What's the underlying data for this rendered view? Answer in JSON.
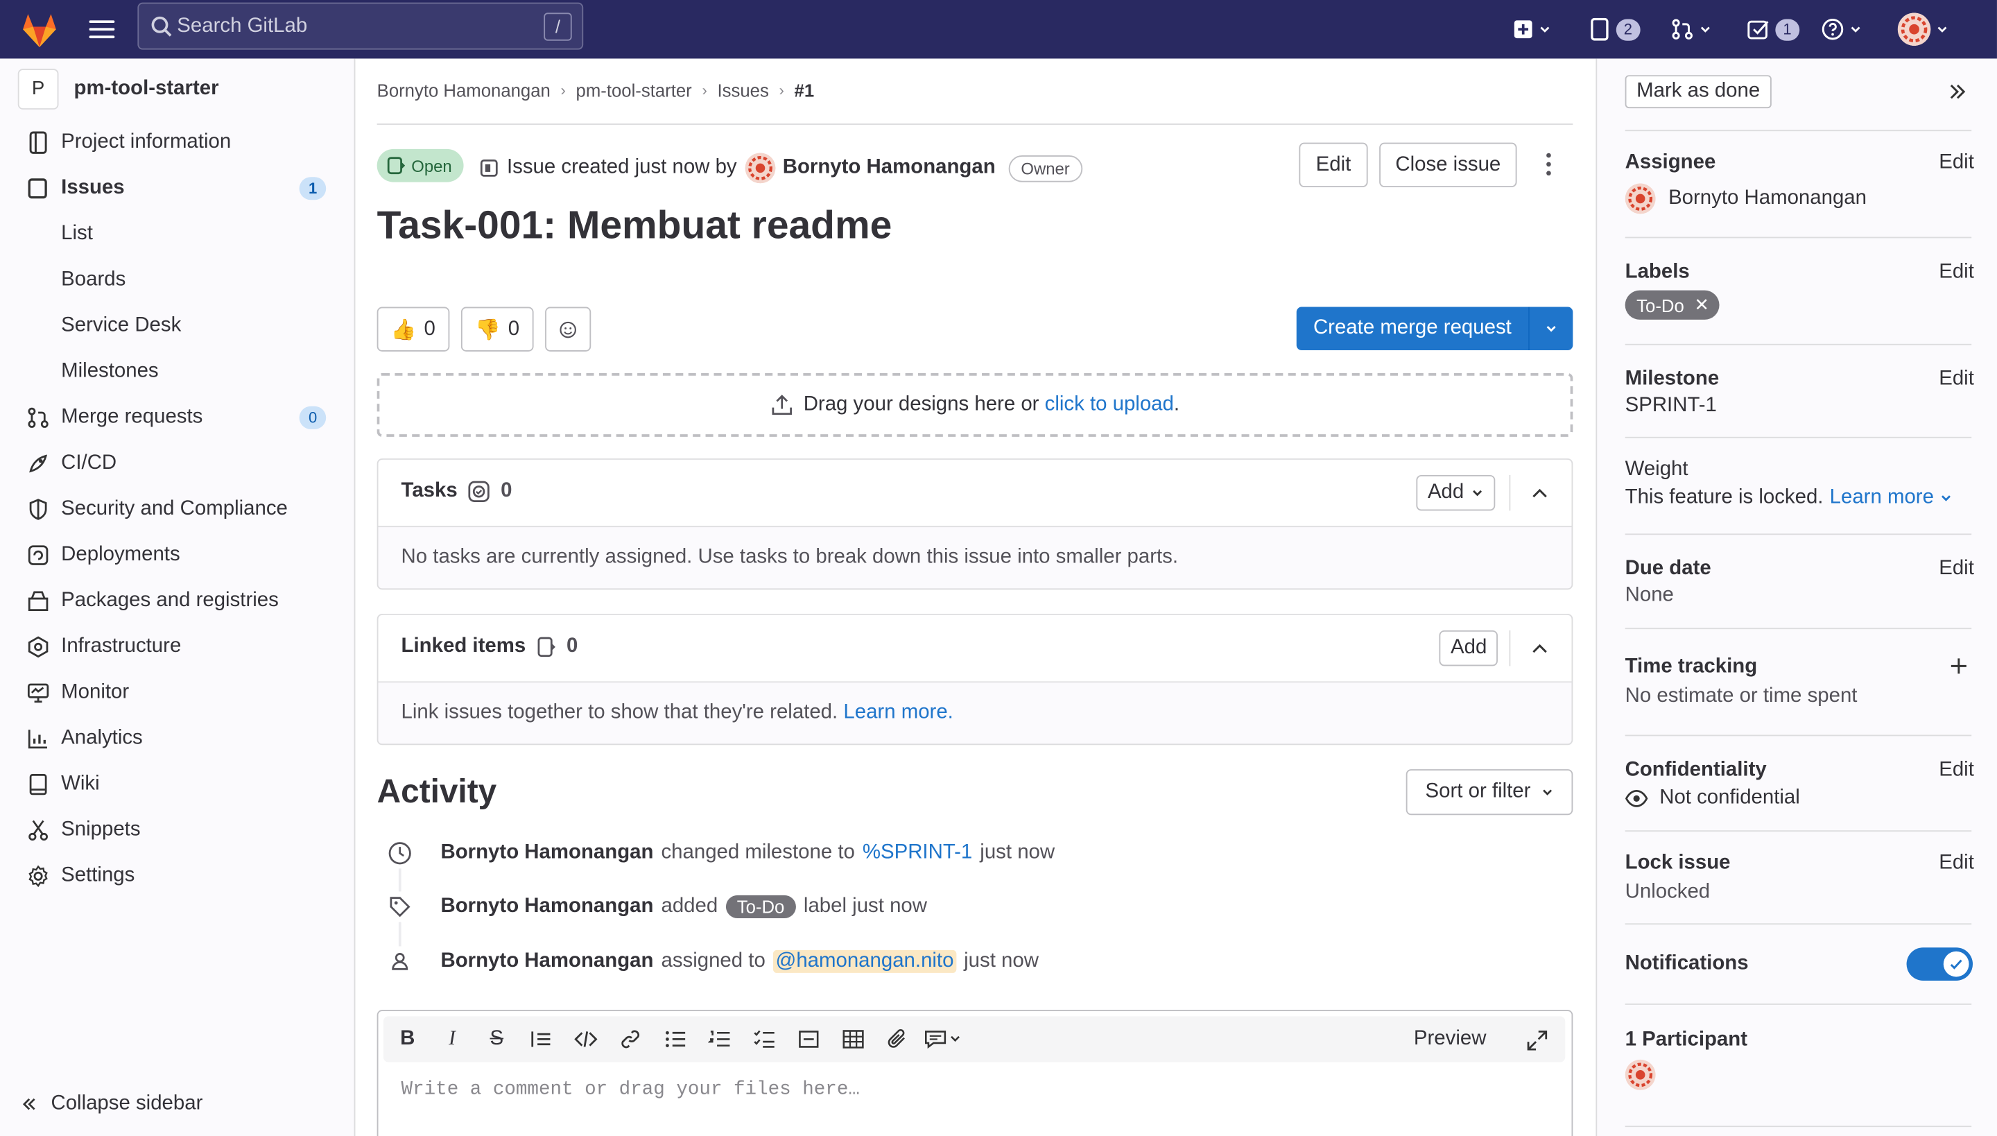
{
  "topbar": {
    "search_placeholder": "Search GitLab",
    "search_shortcut": "/",
    "issues_count": "2",
    "todos_count": "1"
  },
  "sidebar": {
    "project_initial": "P",
    "project_name": "pm-tool-starter",
    "items": [
      {
        "label": "Project information",
        "icon": "info-icon"
      },
      {
        "label": "Issues",
        "icon": "issues-icon",
        "count": "1"
      },
      {
        "label": "List"
      },
      {
        "label": "Boards"
      },
      {
        "label": "Service Desk"
      },
      {
        "label": "Milestones"
      },
      {
        "label": "Merge requests",
        "icon": "merge-request-icon",
        "count": "0"
      },
      {
        "label": "CI/CD",
        "icon": "rocket-icon"
      },
      {
        "label": "Security and Compliance",
        "icon": "shield-icon"
      },
      {
        "label": "Deployments",
        "icon": "deployments-icon"
      },
      {
        "label": "Packages and registries",
        "icon": "package-icon"
      },
      {
        "label": "Infrastructure",
        "icon": "cloud-icon"
      },
      {
        "label": "Monitor",
        "icon": "monitor-icon"
      },
      {
        "label": "Analytics",
        "icon": "chart-icon"
      },
      {
        "label": "Wiki",
        "icon": "book-icon"
      },
      {
        "label": "Snippets",
        "icon": "scissors-icon"
      },
      {
        "label": "Settings",
        "icon": "gear-icon"
      }
    ],
    "collapse_label": "Collapse sidebar"
  },
  "breadcrumb": [
    "Bornyto Hamonangan",
    "pm-tool-starter",
    "Issues",
    "#1"
  ],
  "issue": {
    "status": "Open",
    "created_text": "Issue created just now by",
    "author": "Bornyto Hamonangan",
    "role": "Owner",
    "edit_label": "Edit",
    "close_label": "Close issue",
    "title": "Task-001: Membuat readme",
    "thumbs_up": "0",
    "thumbs_down": "0",
    "create_mr_label": "Create merge request",
    "dropzone_text": "Drag your designs here or",
    "dropzone_link": "click to upload",
    "dropzone_end": "."
  },
  "tasks": {
    "title": "Tasks",
    "count": "0",
    "add_label": "Add",
    "empty_text": "No tasks are currently assigned. Use tasks to break down this issue into smaller parts."
  },
  "linked": {
    "title": "Linked items",
    "count": "0",
    "add_label": "Add",
    "text": "Link issues together to show that they're related.",
    "link": "Learn more."
  },
  "activity": {
    "title": "Activity",
    "sort_label": "Sort or filter",
    "events": [
      {
        "user": "Bornyto Hamonangan",
        "pre": "changed milestone to",
        "ref": "%SPRINT-1",
        "post": "just now"
      },
      {
        "user": "Bornyto Hamonangan",
        "pre": "added",
        "tag": "To-Do",
        "post": "label just now"
      },
      {
        "user": "Bornyto Hamonangan",
        "pre": "assigned to",
        "mention": "@hamonangan.nito",
        "post": "just now"
      }
    ],
    "preview_label": "Preview",
    "comment_placeholder": "Write a comment or drag your files here…"
  },
  "right": {
    "mark_done": "Mark as done",
    "assignee_label": "Assignee",
    "assignee": "Bornyto Hamonangan",
    "edit": "Edit",
    "labels_label": "Labels",
    "label_value": "To-Do",
    "milestone_label": "Milestone",
    "milestone": "SPRINT-1",
    "weight_label": "Weight",
    "weight_text": "This feature is locked.",
    "weight_link": "Learn more",
    "due_label": "Due date",
    "due": "None",
    "time_label": "Time tracking",
    "time": "No estimate or time spent",
    "conf_label": "Confidentiality",
    "conf": "Not confidential",
    "lock_label": "Lock issue",
    "lock": "Unlocked",
    "notif_label": "Notifications",
    "participants_label": "1 Participant"
  },
  "colors": {
    "topbar": "#292961",
    "accent": "#1f75cb",
    "open_bg": "#c3e6cd",
    "label": "#737278"
  }
}
